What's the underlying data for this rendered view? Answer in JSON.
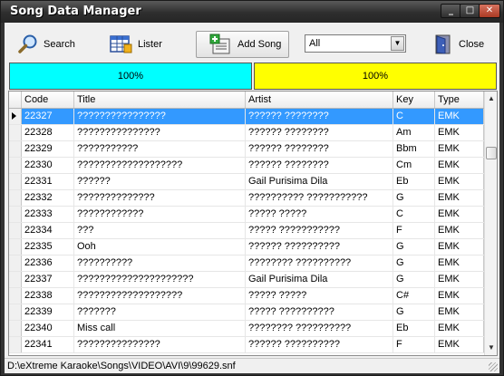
{
  "window": {
    "title": "Song Data Manager"
  },
  "toolbar": {
    "search_label": "Search",
    "lister_label": "Lister",
    "add_song_label": "Add Song",
    "close_label": "Close",
    "filter_value": "All"
  },
  "progress": {
    "left_text": "100%",
    "right_text": "100%",
    "left_fraction": 1.0,
    "right_fraction": 1.0,
    "left_color": "#00ffff",
    "right_color": "#ffff00"
  },
  "table": {
    "columns": [
      "Code",
      "Title",
      "Artist",
      "Key",
      "Type"
    ],
    "rows": [
      {
        "code": "22327",
        "title": "????????????????",
        "artist": "?????? ????????",
        "key": "C",
        "type": "EMK"
      },
      {
        "code": "22328",
        "title": "???????????????",
        "artist": "?????? ????????",
        "key": "Am",
        "type": "EMK"
      },
      {
        "code": "22329",
        "title": "???????????",
        "artist": "?????? ????????",
        "key": "Bbm",
        "type": "EMK"
      },
      {
        "code": "22330",
        "title": "???????????????????",
        "artist": "?????? ????????",
        "key": "Cm",
        "type": "EMK"
      },
      {
        "code": "22331",
        "title": "??????",
        "artist": "Gail Purisima Dila",
        "key": "Eb",
        "type": "EMK"
      },
      {
        "code": "22332",
        "title": "??????????????",
        "artist": "?????????? ???????????",
        "key": "G",
        "type": "EMK"
      },
      {
        "code": "22333",
        "title": "????????????",
        "artist": "????? ?????",
        "key": "C",
        "type": "EMK"
      },
      {
        "code": "22334",
        "title": "???",
        "artist": "????? ???????????",
        "key": "F",
        "type": "EMK"
      },
      {
        "code": "22335",
        "title": "Ooh",
        "artist": "?????? ??????????",
        "key": "G",
        "type": "EMK"
      },
      {
        "code": "22336",
        "title": "??????????",
        "artist": "???????? ??????????",
        "key": "G",
        "type": "EMK"
      },
      {
        "code": "22337",
        "title": "?????????????????????",
        "artist": "Gail Purisima Dila",
        "key": "G",
        "type": "EMK"
      },
      {
        "code": "22338",
        "title": "???????????????????",
        "artist": "????? ?????",
        "key": "C#",
        "type": "EMK"
      },
      {
        "code": "22339",
        "title": "???????",
        "artist": "????? ??????????",
        "key": "G",
        "type": "EMK"
      },
      {
        "code": "22340",
        "title": "Miss call",
        "artist": "???????? ??????????",
        "key": "Eb",
        "type": "EMK"
      },
      {
        "code": "22341",
        "title": "???????????????",
        "artist": "?????? ??????????",
        "key": "F",
        "type": "EMK"
      }
    ]
  },
  "status": {
    "path": "D:\\eXtreme Karaoke\\Songs\\VIDEO\\AVI\\9\\99629.snf"
  }
}
